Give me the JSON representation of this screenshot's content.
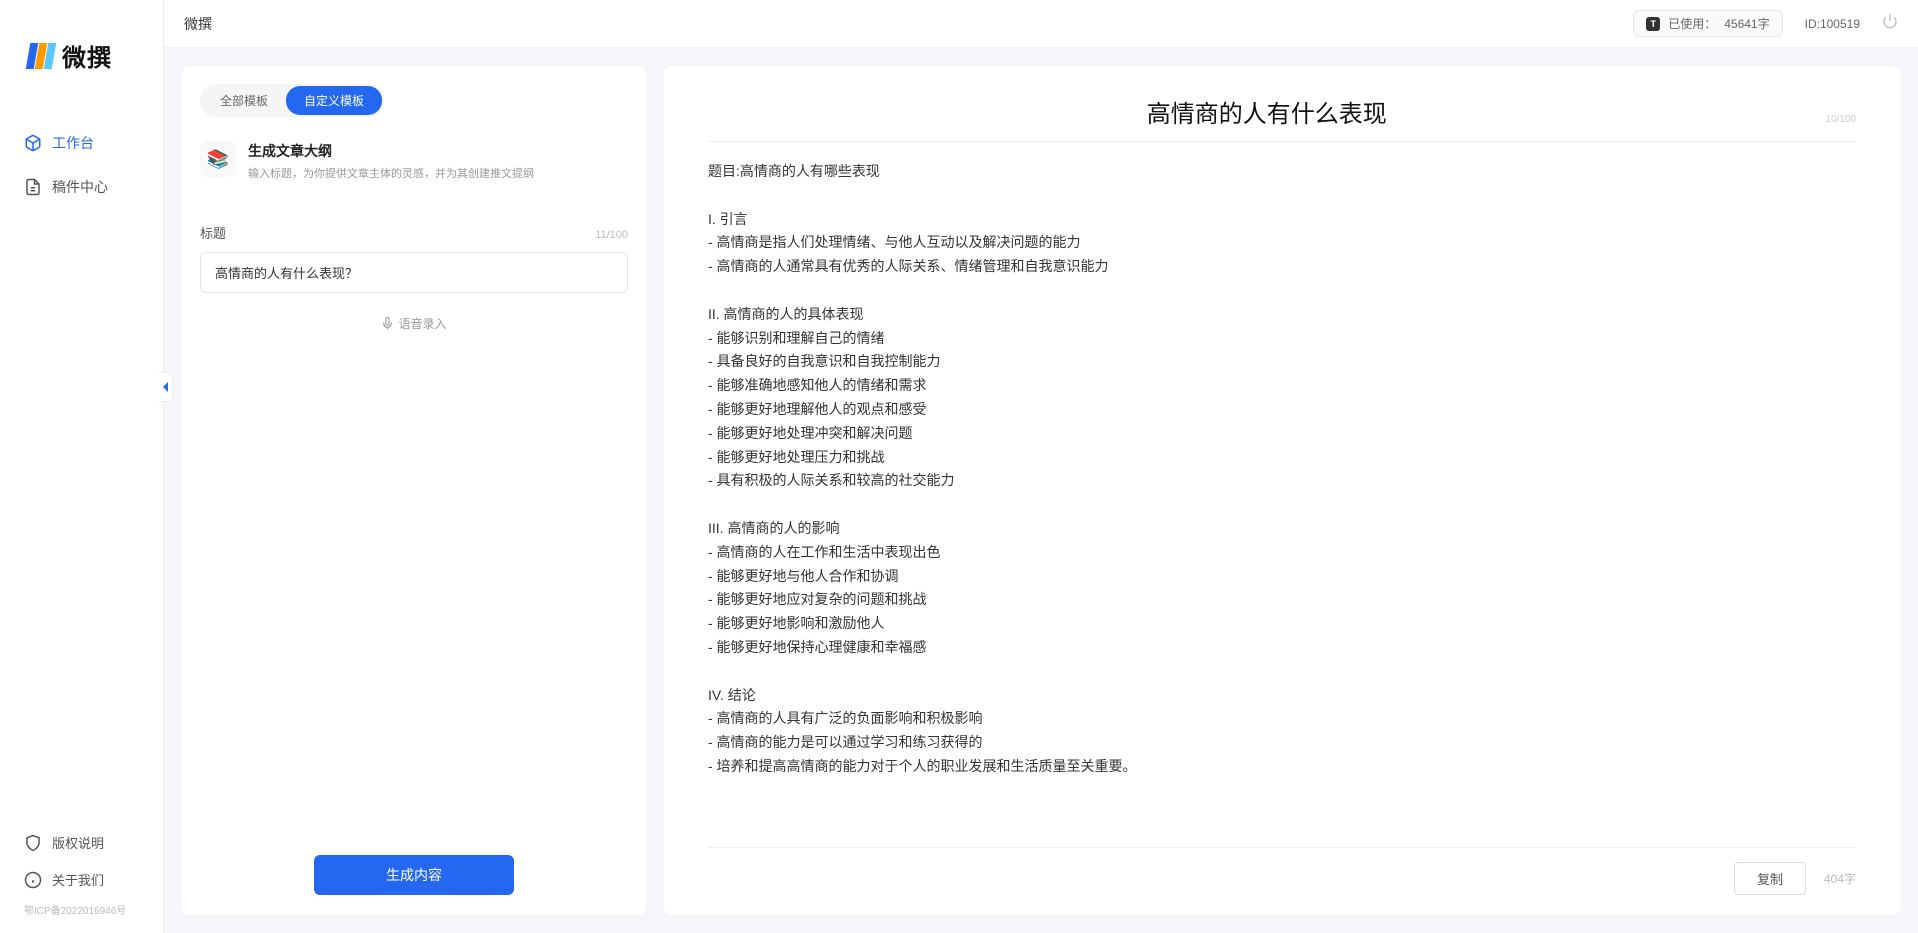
{
  "app": {
    "name": "微撰",
    "logo_colors": [
      "#2468f2",
      "#ff9a00",
      "#5ac8fa"
    ]
  },
  "sidebar": {
    "nav": [
      {
        "label": "工作台",
        "active": true
      },
      {
        "label": "稿件中心",
        "active": false
      }
    ],
    "bottom": [
      {
        "label": "版权说明"
      },
      {
        "label": "关于我们"
      }
    ],
    "icp": "鄂ICP备2022016946号"
  },
  "topbar": {
    "title": "微撰",
    "usage_prefix": "已使用：",
    "usage_value": "45641字",
    "id_label": "ID:100519"
  },
  "leftPanel": {
    "tabs": [
      {
        "label": "全部模板",
        "active": false
      },
      {
        "label": "自定义模板",
        "active": true
      }
    ],
    "template": {
      "icon_emoji": "📚",
      "title": "生成文章大纲",
      "desc": "输入标题，为你提供文章主体的灵感，并为其创建推文提纲"
    },
    "field_label": "标题",
    "char_count": "11/100",
    "input_value": "高情商的人有什么表现？",
    "voice_hint": "语音录入",
    "generate_label": "生成内容"
  },
  "rightPanel": {
    "doc_title": "高情商的人有什么表现",
    "title_count": "10/100",
    "body": "题目:高情商的人有哪些表现\n\nI. 引言\n- 高情商是指人们处理情绪、与他人互动以及解决问题的能力\n- 高情商的人通常具有优秀的人际关系、情绪管理和自我意识能力\n\nII. 高情商的人的具体表现\n- 能够识别和理解自己的情绪\n- 具备良好的自我意识和自我控制能力\n- 能够准确地感知他人的情绪和需求\n- 能够更好地理解他人的观点和感受\n- 能够更好地处理冲突和解决问题\n- 能够更好地处理压力和挑战\n- 具有积极的人际关系和较高的社交能力\n\nIII. 高情商的人的影响\n- 高情商的人在工作和生活中表现出色\n- 能够更好地与他人合作和协调\n- 能够更好地应对复杂的问题和挑战\n- 能够更好地影响和激励他人\n- 能够更好地保持心理健康和幸福感\n\nIV. 结论\n- 高情商的人具有广泛的负面影响和积极影响\n- 高情商的能力是可以通过学习和练习获得的\n- 培养和提高高情商的能力对于个人的职业发展和生活质量至关重要。",
    "copy_label": "复制",
    "word_count": "404字"
  }
}
